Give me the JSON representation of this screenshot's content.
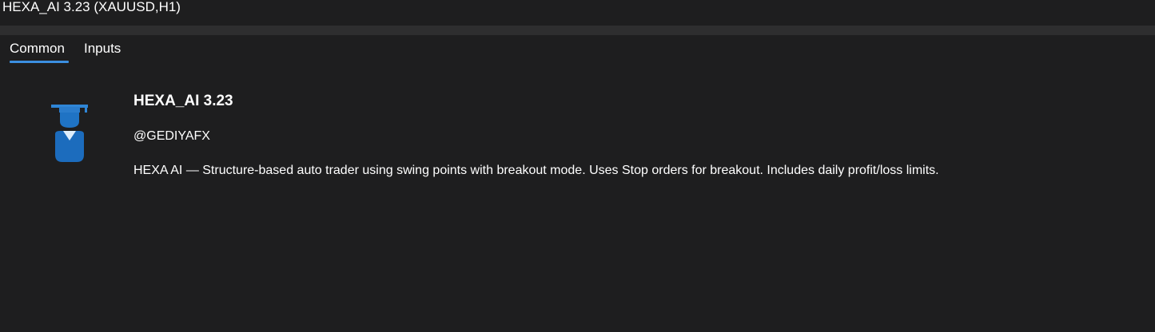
{
  "window": {
    "title": "HEXA_AI 3.23 (XAUUSD,H1)"
  },
  "tabs": [
    {
      "label": "Common",
      "active": true
    },
    {
      "label": "Inputs",
      "active": false
    }
  ],
  "expert": {
    "icon": "graduate-cap-icon",
    "name": "HEXA_AI 3.23",
    "author": "@GEDIYAFX",
    "description": "HEXA AI — Structure-based auto trader using swing points with breakout mode. Uses Stop orders for breakout. Includes daily profit/loss limits."
  },
  "colors": {
    "background": "#1e1e1f",
    "accent": "#3b8fe0",
    "icon_blue": "#2f86d6"
  }
}
